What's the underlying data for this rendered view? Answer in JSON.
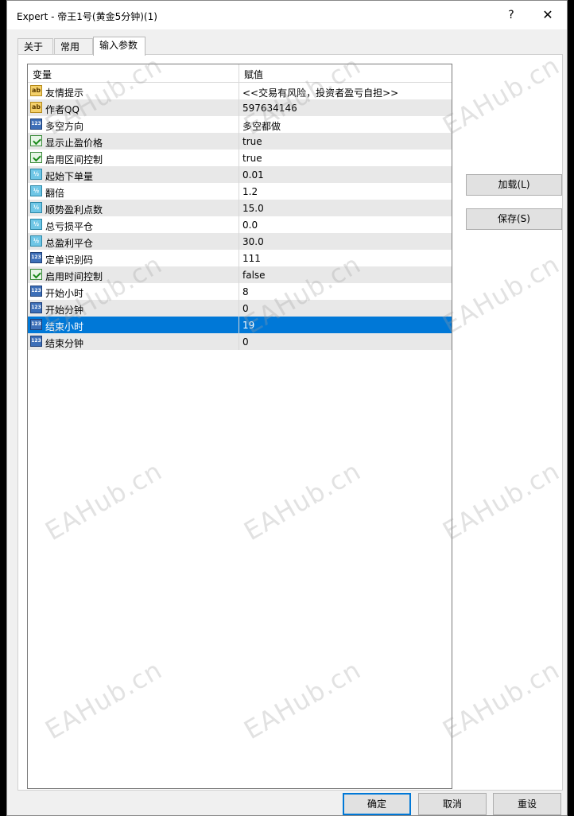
{
  "window": {
    "title": "Expert - 帝王1号(黄金5分钟)(1)",
    "help_label": "?",
    "close_label": "✕"
  },
  "tabs": [
    {
      "label": "关于",
      "active": false
    },
    {
      "label": "常用",
      "active": false
    },
    {
      "label": "输入参数",
      "active": true
    }
  ],
  "grid": {
    "headers": {
      "name": "变量",
      "value": "赋值"
    },
    "rows": [
      {
        "icon": "ab",
        "name": "友情提示",
        "value": "<<交易有风险，投资者盈亏自担>>"
      },
      {
        "icon": "ab",
        "name": "作者QQ",
        "value": "597634146"
      },
      {
        "icon": "123",
        "name": "多空方向",
        "value": "多空都做"
      },
      {
        "icon": "bool",
        "name": "显示止盈价格",
        "value": "true"
      },
      {
        "icon": "bool",
        "name": "启用区间控制",
        "value": "true"
      },
      {
        "icon": "dbl",
        "name": "起始下单量",
        "value": "0.01"
      },
      {
        "icon": "dbl",
        "name": "翻倍",
        "value": "1.2"
      },
      {
        "icon": "dbl",
        "name": "顺势盈利点数",
        "value": "15.0"
      },
      {
        "icon": "dbl",
        "name": "总亏损平仓",
        "value": "0.0"
      },
      {
        "icon": "dbl",
        "name": "总盈利平仓",
        "value": "30.0"
      },
      {
        "icon": "123",
        "name": "定单识别码",
        "value": "111"
      },
      {
        "icon": "bool",
        "name": "启用时间控制",
        "value": "false"
      },
      {
        "icon": "123",
        "name": "开始小时",
        "value": "8"
      },
      {
        "icon": "123",
        "name": "开始分钟",
        "value": "0"
      },
      {
        "icon": "123",
        "name": "结束小时",
        "value": "19",
        "selected": true
      },
      {
        "icon": "123",
        "name": "结束分钟",
        "value": "0"
      }
    ]
  },
  "buttons": {
    "load": "加载(L)",
    "save": "保存(S)",
    "ok": "确定",
    "cancel": "取消",
    "reset": "重设"
  },
  "icon_labels": {
    "ab": "ab",
    "123": "123",
    "dbl": "½",
    "bool": ""
  },
  "watermark": "EAHub.cn",
  "colors": {
    "selection": "#0078d7",
    "alt_row": "#e8e8e8"
  }
}
